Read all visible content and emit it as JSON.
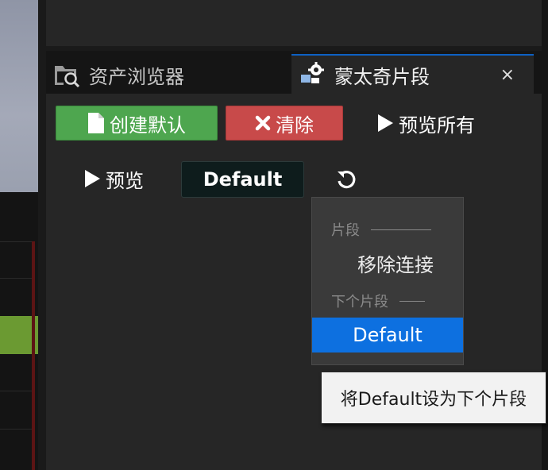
{
  "tabs": {
    "assets": {
      "label": "资产浏览器",
      "icon": "folder-search-icon"
    },
    "montage": {
      "label": "蒙太奇片段",
      "icon": "montage-gear-icon",
      "close": "×"
    }
  },
  "toolbar": {
    "create_label": "创建默认",
    "clear_label": "清除",
    "preview_all_label": "预览所有"
  },
  "preview": {
    "preview_label": "预览",
    "current_section": "Default",
    "reset_icon": "refresh-icon"
  },
  "dropdown": {
    "header_section": "片段",
    "remove_link": "移除连接",
    "header_next": "下个片段",
    "options": [
      "Default"
    ]
  },
  "tooltip": {
    "text": "将Default设为下个片段"
  },
  "colors": {
    "create_green": "#4ea64f",
    "clear_red": "#c84a4a",
    "selection_blue": "#0d70e0",
    "tab_accent": "#0d60c4"
  }
}
